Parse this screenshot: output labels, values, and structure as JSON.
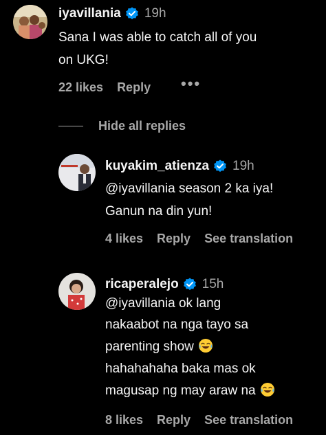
{
  "colors": {
    "background": "#000000",
    "primary_text": "#f5f5f5",
    "secondary_text": "#a8a8a8",
    "verified_badge": "#0095f6"
  },
  "comments": [
    {
      "username": "iyavillania",
      "verified": true,
      "time": "19h",
      "lines": [
        "Sana I was able to catch all of you",
        "on UKG!"
      ],
      "likes": "22 likes",
      "reply_label": "Reply",
      "more_icon": "more-horizontal-icon"
    }
  ],
  "hide_replies_label": "Hide all replies",
  "replies": [
    {
      "username": "kuyakim_atienza",
      "verified": true,
      "time": "19h",
      "lines": [
        "@iyavillania season 2 ka iya!",
        "Ganun na din yun!"
      ],
      "likes": "4 likes",
      "reply_label": "Reply",
      "translate_label": "See translation"
    },
    {
      "username": "ricaperalejo",
      "verified": true,
      "time": "15h",
      "lines": [
        "@iyavillania ok lang",
        "nakaabot na nga tayo sa",
        "parenting show",
        "hahahahaha baka mas ok",
        "magusap ng may araw na"
      ],
      "emoji_icon": "face-with-tears-of-joy-icon",
      "likes": "8 likes",
      "reply_label": "Reply",
      "translate_label": "See translation"
    }
  ]
}
